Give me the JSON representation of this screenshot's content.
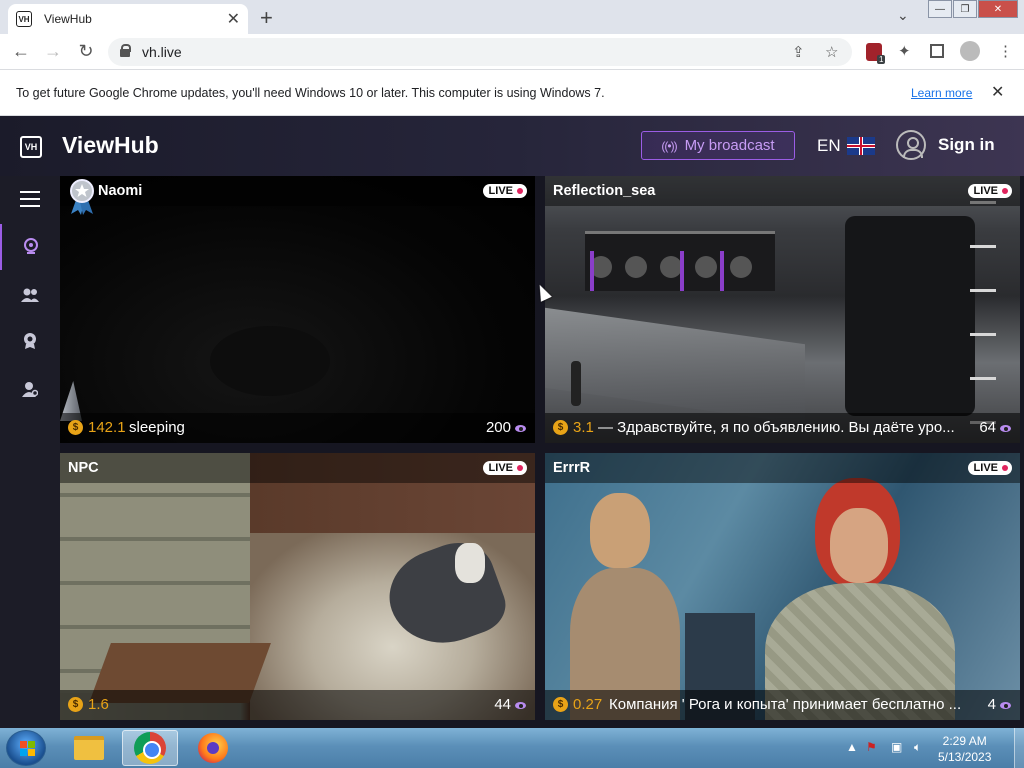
{
  "browser": {
    "tab_title": "ViewHub",
    "tab_favicon": "VH",
    "new_tab": "+",
    "url": "vh.live",
    "ext_badge": "1"
  },
  "infobar": {
    "message": "To get future Google Chrome updates, you'll need Windows 10 or later. This computer is using Windows 7.",
    "link": "Learn more"
  },
  "site": {
    "logo_mark": "VH",
    "logo_text": "ViewHub",
    "broadcast_label": "My broadcast",
    "lang": "EN",
    "signin": "Sign in"
  },
  "streams": [
    {
      "name": "Naomi",
      "live": "LIVE",
      "price": "142.1",
      "desc": "sleeping",
      "viewers": "200"
    },
    {
      "name": "Reflection_sea",
      "live": "LIVE",
      "price": "3.1",
      "desc": "— Здравствуйте, я по объявлению. Вы даёте уро...",
      "viewers": "64"
    },
    {
      "name": "NPC",
      "live": "LIVE",
      "price": "1.6",
      "desc": "",
      "viewers": "44"
    },
    {
      "name": "ErrrR",
      "live": "LIVE",
      "price": "0.27",
      "desc": "Компания ' Рога и копыта' принимает бесплатно ...",
      "viewers": "4"
    }
  ],
  "coin_symbol": "$",
  "taskbar": {
    "time": "2:29 AM",
    "date": "5/13/2023"
  },
  "colors": {
    "accent": "#9b5de5",
    "coin": "#e8a317",
    "live_dot": "#e0245e"
  }
}
